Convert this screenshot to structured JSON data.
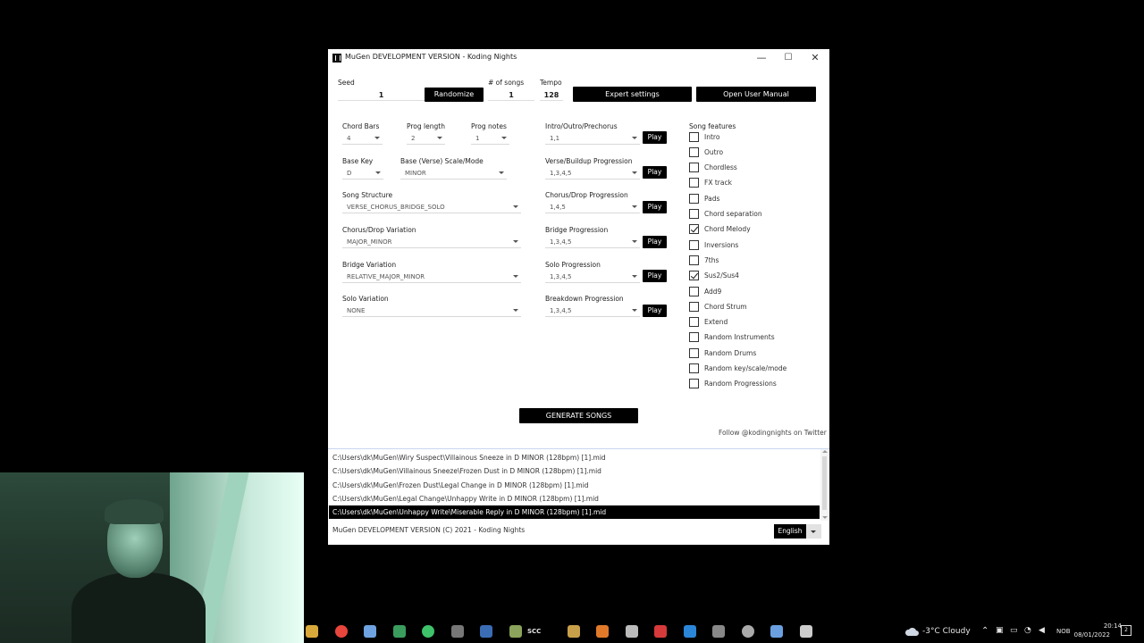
{
  "window": {
    "title": "MuGen  DEVELOPMENT VERSION - Koding Nights",
    "controls": {
      "minimize": "—",
      "maximize": "☐",
      "close": "✕"
    }
  },
  "top": {
    "seed_label": "Seed",
    "seed_value": "1",
    "randomize_label": "Randomize",
    "songs_label": "# of songs",
    "songs_value": "1",
    "tempo_label": "Tempo",
    "tempo_value": "128",
    "expert_label": "Expert settings",
    "manual_label": "Open User Manual"
  },
  "left": {
    "chord_bars": {
      "label": "Chord Bars",
      "value": "4"
    },
    "prog_length": {
      "label": "Prog length",
      "value": "2"
    },
    "prog_notes": {
      "label": "Prog notes",
      "value": "1"
    },
    "base_key": {
      "label": "Base Key",
      "value": "D"
    },
    "base_scale": {
      "label": "Base (Verse) Scale/Mode",
      "value": "MINOR"
    },
    "song_structure": {
      "label": "Song Structure",
      "value": "VERSE_CHORUS_BRIDGE_SOLO"
    },
    "chorus_variation": {
      "label": "Chorus/Drop Variation",
      "value": "MAJOR_MINOR"
    },
    "bridge_variation": {
      "label": "Bridge Variation",
      "value": "RELATIVE_MAJOR_MINOR"
    },
    "solo_variation": {
      "label": "Solo Variation",
      "value": "NONE"
    }
  },
  "progressions": {
    "play_label": "Play",
    "items": [
      {
        "label": "Intro/Outro/Prechorus",
        "value": "1,1"
      },
      {
        "label": "Verse/Buildup Progression",
        "value": "1,3,4,5"
      },
      {
        "label": "Chorus/Drop Progression",
        "value": "1,4,5"
      },
      {
        "label": "Bridge Progression",
        "value": "1,3,4,5"
      },
      {
        "label": "Solo Progression",
        "value": "1,3,4,5"
      },
      {
        "label": "Breakdown Progression",
        "value": "1,3,4,5"
      }
    ]
  },
  "features": {
    "label": "Song features",
    "items": [
      {
        "label": "Intro",
        "checked": false
      },
      {
        "label": "Outro",
        "checked": false
      },
      {
        "label": "Chordless",
        "checked": false
      },
      {
        "label": "FX track",
        "checked": false
      },
      {
        "label": "Pads",
        "checked": false
      },
      {
        "label": "Chord separation",
        "checked": false
      },
      {
        "label": "Chord Melody",
        "checked": true
      },
      {
        "label": "Inversions",
        "checked": false
      },
      {
        "label": "7ths",
        "checked": false
      },
      {
        "label": "Sus2/Sus4",
        "checked": true
      },
      {
        "label": "Add9",
        "checked": false
      },
      {
        "label": "Chord Strum",
        "checked": false
      },
      {
        "label": "Extend",
        "checked": false
      },
      {
        "label": "Random Instruments",
        "checked": false
      },
      {
        "label": "Random Drums",
        "checked": false
      },
      {
        "label": "Random key/scale/mode",
        "checked": false
      },
      {
        "label": "Random Progressions",
        "checked": false
      }
    ]
  },
  "generate_label": "GENERATE SONGS",
  "twitter_text": "Follow @kodingnights on Twitter",
  "log": {
    "rows": [
      "C:\\Users\\dk\\MuGen\\Wiry Suspect\\Villainous Sneeze in D MINOR (128bpm) [1].mid",
      "C:\\Users\\dk\\MuGen\\Villainous Sneeze\\Frozen Dust in D MINOR (128bpm) [1].mid",
      "C:\\Users\\dk\\MuGen\\Frozen Dust\\Legal Change in D MINOR (128bpm) [1].mid",
      "C:\\Users\\dk\\MuGen\\Legal Change\\Unhappy Write in D MINOR (128bpm) [1].mid",
      "C:\\Users\\dk\\MuGen\\Unhappy Write\\Miserable Reply in D MINOR (128bpm) [1].mid"
    ],
    "selected_index": 4
  },
  "footer": {
    "text": "MuGen  DEVELOPMENT VERSION (C) 2021 - Koding Nights",
    "language": "English"
  },
  "taskbar": {
    "weather": "-3°C  Cloudy",
    "lang": "NOB",
    "time": "20:14",
    "date": "08/01/2022",
    "notifications": "2",
    "scc_label": "SCC",
    "icons": [
      "folder-icon",
      "chrome-icon",
      "git-icon",
      "app-icon",
      "whatsapp-icon",
      "epic-games-icon",
      "steam-icon",
      "cube-icon",
      "scc-icon",
      "media-icon",
      "fl-studio-icon",
      "snip-icon",
      "acrobat-icon",
      "vscode-icon",
      "gamepad-icon",
      "unity-icon",
      "tool-icon",
      "terminal-icon"
    ]
  }
}
